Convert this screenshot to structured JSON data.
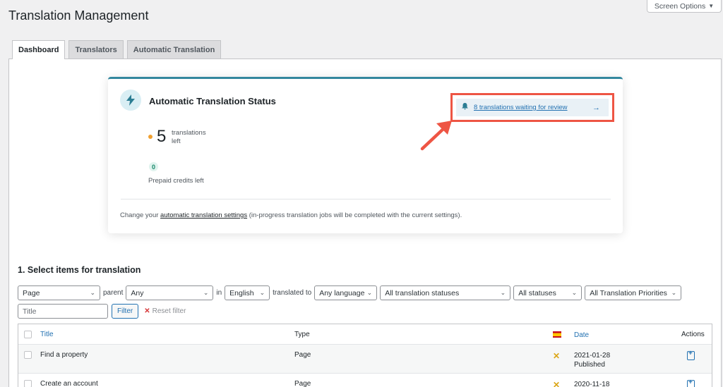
{
  "page": {
    "title": "Translation Management",
    "screen_options": "Screen Options"
  },
  "tabs": [
    {
      "label": "Dashboard",
      "active": true
    },
    {
      "label": "Translators",
      "active": false
    },
    {
      "label": "Automatic Translation",
      "active": false
    }
  ],
  "status_card": {
    "title": "Automatic Translation Status",
    "count": "5",
    "count_caption": "translations left",
    "credits": "0",
    "credits_caption": "Prepaid credits left",
    "review_link": "8 translations waiting for review",
    "footer_prefix": "Change your ",
    "footer_link": "automatic translation settings",
    "footer_suffix": " (in-progress translation jobs will be completed with the current settings).",
    "accent_color": "#33879e",
    "highlight_color": "#ee5544"
  },
  "section": {
    "heading": "1. Select items for translation"
  },
  "filters": {
    "type": "Page",
    "parent_label": "parent",
    "parent": "Any",
    "in_label": "in",
    "from_language": "English",
    "translated_to_label": "translated to",
    "to_language": "Any language",
    "translation_status": "All translation statuses",
    "post_status": "All statuses",
    "priority": "All Translation Priorities",
    "title_placeholder": "Title",
    "filter_button": "Filter",
    "reset_label": "Reset filter"
  },
  "table": {
    "headers": {
      "title": "Title",
      "type": "Type",
      "date": "Date",
      "actions": "Actions"
    },
    "rows": [
      {
        "title": "Find a property",
        "type": "Page",
        "date": "2021-01-28",
        "status": "Published"
      },
      {
        "title": "Create an account",
        "type": "Page",
        "date": "2020-11-18",
        "status": ""
      }
    ]
  }
}
